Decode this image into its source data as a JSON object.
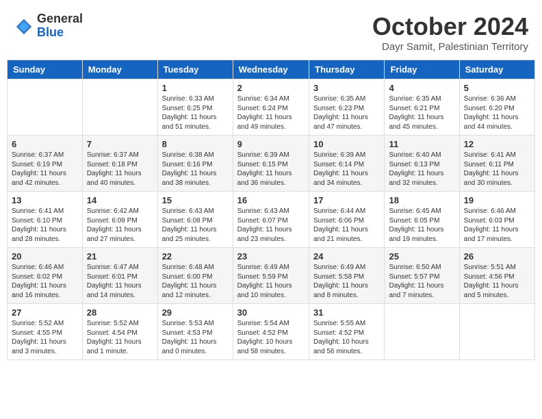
{
  "header": {
    "logo_general": "General",
    "logo_blue": "Blue",
    "month_title": "October 2024",
    "subtitle": "Dayr Samit, Palestinian Territory"
  },
  "days_of_week": [
    "Sunday",
    "Monday",
    "Tuesday",
    "Wednesday",
    "Thursday",
    "Friday",
    "Saturday"
  ],
  "weeks": [
    [
      {
        "day": "",
        "info": ""
      },
      {
        "day": "",
        "info": ""
      },
      {
        "day": "1",
        "info": "Sunrise: 6:33 AM\nSunset: 6:25 PM\nDaylight: 11 hours and 51 minutes."
      },
      {
        "day": "2",
        "info": "Sunrise: 6:34 AM\nSunset: 6:24 PM\nDaylight: 11 hours and 49 minutes."
      },
      {
        "day": "3",
        "info": "Sunrise: 6:35 AM\nSunset: 6:23 PM\nDaylight: 11 hours and 47 minutes."
      },
      {
        "day": "4",
        "info": "Sunrise: 6:35 AM\nSunset: 6:21 PM\nDaylight: 11 hours and 45 minutes."
      },
      {
        "day": "5",
        "info": "Sunrise: 6:36 AM\nSunset: 6:20 PM\nDaylight: 11 hours and 44 minutes."
      }
    ],
    [
      {
        "day": "6",
        "info": "Sunrise: 6:37 AM\nSunset: 6:19 PM\nDaylight: 11 hours and 42 minutes."
      },
      {
        "day": "7",
        "info": "Sunrise: 6:37 AM\nSunset: 6:18 PM\nDaylight: 11 hours and 40 minutes."
      },
      {
        "day": "8",
        "info": "Sunrise: 6:38 AM\nSunset: 6:16 PM\nDaylight: 11 hours and 38 minutes."
      },
      {
        "day": "9",
        "info": "Sunrise: 6:39 AM\nSunset: 6:15 PM\nDaylight: 11 hours and 36 minutes."
      },
      {
        "day": "10",
        "info": "Sunrise: 6:39 AM\nSunset: 6:14 PM\nDaylight: 11 hours and 34 minutes."
      },
      {
        "day": "11",
        "info": "Sunrise: 6:40 AM\nSunset: 6:13 PM\nDaylight: 11 hours and 32 minutes."
      },
      {
        "day": "12",
        "info": "Sunrise: 6:41 AM\nSunset: 6:11 PM\nDaylight: 11 hours and 30 minutes."
      }
    ],
    [
      {
        "day": "13",
        "info": "Sunrise: 6:41 AM\nSunset: 6:10 PM\nDaylight: 11 hours and 28 minutes."
      },
      {
        "day": "14",
        "info": "Sunrise: 6:42 AM\nSunset: 6:09 PM\nDaylight: 11 hours and 27 minutes."
      },
      {
        "day": "15",
        "info": "Sunrise: 6:43 AM\nSunset: 6:08 PM\nDaylight: 11 hours and 25 minutes."
      },
      {
        "day": "16",
        "info": "Sunrise: 6:43 AM\nSunset: 6:07 PM\nDaylight: 11 hours and 23 minutes."
      },
      {
        "day": "17",
        "info": "Sunrise: 6:44 AM\nSunset: 6:06 PM\nDaylight: 11 hours and 21 minutes."
      },
      {
        "day": "18",
        "info": "Sunrise: 6:45 AM\nSunset: 6:05 PM\nDaylight: 11 hours and 19 minutes."
      },
      {
        "day": "19",
        "info": "Sunrise: 6:46 AM\nSunset: 6:03 PM\nDaylight: 11 hours and 17 minutes."
      }
    ],
    [
      {
        "day": "20",
        "info": "Sunrise: 6:46 AM\nSunset: 6:02 PM\nDaylight: 11 hours and 16 minutes."
      },
      {
        "day": "21",
        "info": "Sunrise: 6:47 AM\nSunset: 6:01 PM\nDaylight: 11 hours and 14 minutes."
      },
      {
        "day": "22",
        "info": "Sunrise: 6:48 AM\nSunset: 6:00 PM\nDaylight: 11 hours and 12 minutes."
      },
      {
        "day": "23",
        "info": "Sunrise: 6:49 AM\nSunset: 5:59 PM\nDaylight: 11 hours and 10 minutes."
      },
      {
        "day": "24",
        "info": "Sunrise: 6:49 AM\nSunset: 5:58 PM\nDaylight: 11 hours and 8 minutes."
      },
      {
        "day": "25",
        "info": "Sunrise: 6:50 AM\nSunset: 5:57 PM\nDaylight: 11 hours and 7 minutes."
      },
      {
        "day": "26",
        "info": "Sunrise: 5:51 AM\nSunset: 4:56 PM\nDaylight: 11 hours and 5 minutes."
      }
    ],
    [
      {
        "day": "27",
        "info": "Sunrise: 5:52 AM\nSunset: 4:55 PM\nDaylight: 11 hours and 3 minutes."
      },
      {
        "day": "28",
        "info": "Sunrise: 5:52 AM\nSunset: 4:54 PM\nDaylight: 11 hours and 1 minute."
      },
      {
        "day": "29",
        "info": "Sunrise: 5:53 AM\nSunset: 4:53 PM\nDaylight: 11 hours and 0 minutes."
      },
      {
        "day": "30",
        "info": "Sunrise: 5:54 AM\nSunset: 4:52 PM\nDaylight: 10 hours and 58 minutes."
      },
      {
        "day": "31",
        "info": "Sunrise: 5:55 AM\nSunset: 4:52 PM\nDaylight: 10 hours and 56 minutes."
      },
      {
        "day": "",
        "info": ""
      },
      {
        "day": "",
        "info": ""
      }
    ]
  ]
}
